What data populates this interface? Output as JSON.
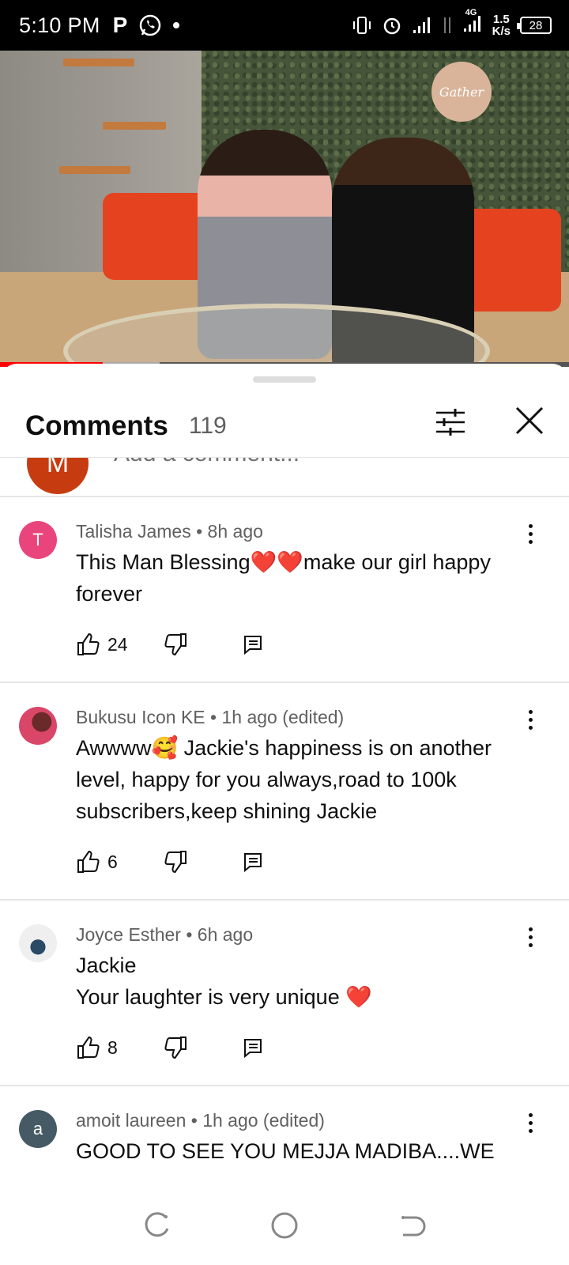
{
  "status_bar": {
    "time": "5:10 PM",
    "network_type": "4G",
    "speed_value": "1.5",
    "speed_unit": "K/s",
    "battery": "28"
  },
  "video": {
    "sign_text": "Gather",
    "progress_played_fraction": 0.18,
    "progress_buffered_fraction": 0.28
  },
  "comments_panel": {
    "title": "Comments",
    "count": "119",
    "add_comment_placeholder": "Add a comment...",
    "current_user_initial": "M",
    "comments": [
      {
        "author": "Talisha James",
        "time": "8h ago",
        "edited": "",
        "meta": "Talisha James • 8h ago",
        "text": "This Man Blessing❤️❤️make our girl happy forever",
        "likes": "24",
        "avatar_initial": "T",
        "avatar_color": "#e9457c"
      },
      {
        "author": "Bukusu Icon KE",
        "time": "1h ago",
        "edited": "(edited)",
        "meta": "Bukusu Icon KE • 1h ago (edited)",
        "text": "Awwww🥰 Jackie's happiness is on another level, happy for you always,road to 100k subscribers,keep shining Jackie",
        "likes": "6",
        "avatar_initial": "",
        "avatar_color": "#c21e4a"
      },
      {
        "author": "Joyce Esther",
        "time": "6h ago",
        "edited": "",
        "meta": "Joyce Esther • 6h ago",
        "text_line1": "Jackie",
        "text_line2": "Your laughter is very unique ❤️",
        "likes": "8",
        "avatar_initial": "",
        "avatar_color": "#d7d7d7"
      },
      {
        "author": "amoit laureen",
        "time": "1h ago",
        "edited": "(edited)",
        "meta": "amoit laureen • 1h ago (edited)",
        "text": "GOOD TO SEE YOU MEJJA  MADIBA....WE",
        "likes": "",
        "avatar_initial": "a",
        "avatar_color": "#455a64"
      }
    ]
  },
  "colors": {
    "accent_red": "#ff0000",
    "text_primary": "#0f0f0f",
    "text_secondary": "#606060"
  }
}
